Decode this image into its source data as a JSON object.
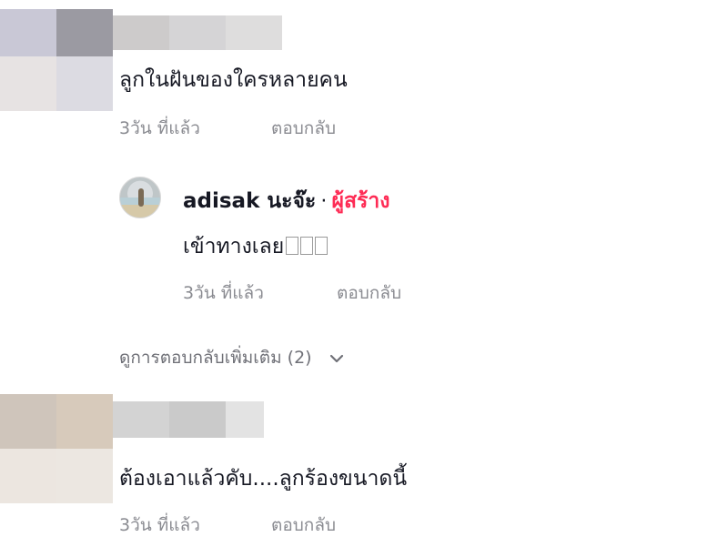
{
  "comments": [
    {
      "text": "ลูกในฝันของใครหลายคน",
      "time": "3วัน ที่แล้ว",
      "reply_label": "ตอบกลับ"
    },
    {
      "text": "ต้องเอาแล้วคับ....ลูกร้องขนาดนี้",
      "time": "3วัน ที่แล้ว",
      "reply_label": "ตอบกลับ"
    }
  ],
  "reply": {
    "username": "adisak นะจ๊ะ",
    "separator": "·",
    "creator_badge": "ผู้สร้าง",
    "creator_color": "#fe2c55",
    "text": "เข้าทางเลย",
    "time": "3วัน ที่แล้ว",
    "reply_label": "ตอบกลับ"
  },
  "view_more_replies": "ดูการตอบกลับเพิ่มเติม (2)",
  "icons": {
    "expand": "chevron-down-icon"
  }
}
